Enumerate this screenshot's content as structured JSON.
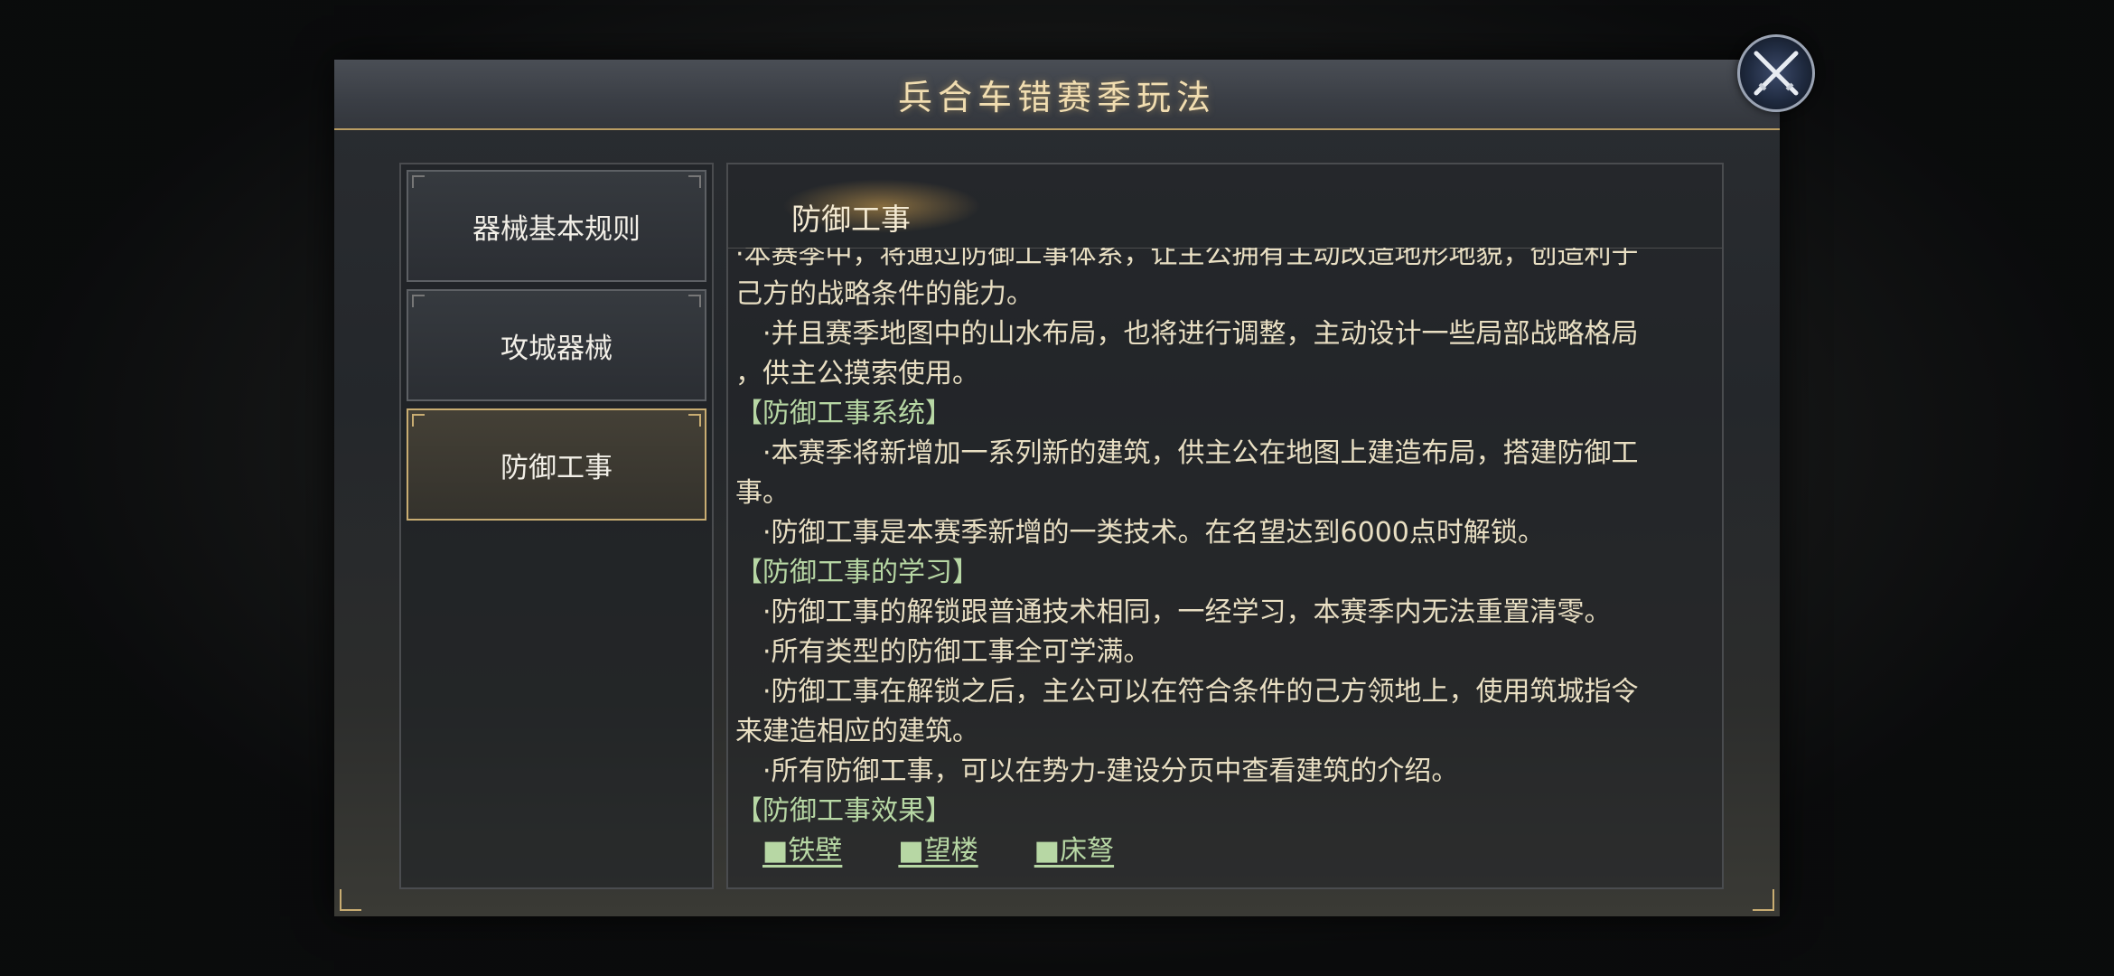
{
  "dialog": {
    "title": "兵合车错赛季玩法"
  },
  "close_button": {
    "icon": "crossed-swords-close-icon"
  },
  "nav": {
    "items": [
      {
        "label": "器械基本规则",
        "active": false
      },
      {
        "label": "攻城器械",
        "active": false
      },
      {
        "label": "防御工事",
        "active": true
      }
    ]
  },
  "content": {
    "title": "防御工事",
    "lines": [
      {
        "text": "·本赛季中，将通过防御工事体系，让主公拥有主动改造地形地貌，创造利于",
        "type": "body"
      },
      {
        "text": "己方的战略条件的能力。",
        "type": "body"
      },
      {
        "text": "　·并且赛季地图中的山水布局，也将进行调整，主动设计一些局部战略格局",
        "type": "body"
      },
      {
        "text": "，供主公摸索使用。",
        "type": "body"
      },
      {
        "text": "【防御工事系统】",
        "type": "section"
      },
      {
        "text": "　·本赛季将新增加一系列新的建筑，供主公在地图上建造布局，搭建防御工",
        "type": "body"
      },
      {
        "text": "事。",
        "type": "body"
      },
      {
        "text": "　·防御工事是本赛季新增的一类技术。在名望达到6000点时解锁。",
        "type": "body"
      },
      {
        "text": "【防御工事的学习】",
        "type": "section"
      },
      {
        "text": "　·防御工事的解锁跟普通技术相同，一经学习，本赛季内无法重置清零。",
        "type": "body"
      },
      {
        "text": "　·所有类型的防御工事全可学满。",
        "type": "body"
      },
      {
        "text": "　·防御工事在解锁之后，主公可以在符合条件的己方领地上，使用筑城指令",
        "type": "body"
      },
      {
        "text": "来建造相应的建筑。",
        "type": "body"
      },
      {
        "text": "　·所有防御工事，可以在势力-建设分页中查看建筑的介绍。",
        "type": "body"
      },
      {
        "text": "【防御工事效果】",
        "type": "section"
      }
    ],
    "links": [
      "■铁壁",
      "■望楼",
      "■床弩"
    ]
  },
  "colors": {
    "accent_gold": "#c9ad72",
    "title_text": "#f1ddb0",
    "section_green": "#b7d7a4",
    "body_text": "#e9dfc3"
  }
}
